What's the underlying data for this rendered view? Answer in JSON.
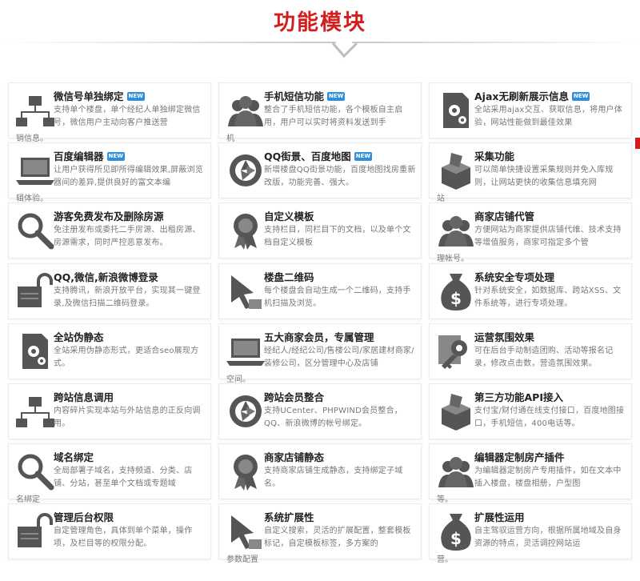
{
  "header": {
    "title": "功能模块",
    "accent": "#d41e1e"
  },
  "badge_color": "#2f8fdd",
  "modules": [
    {
      "name": "微信号单独绑定",
      "badge": "NEW",
      "desc": "支持单个楼盘，单个经纪人单独绑定微信号，微信用户主动向客户推送营",
      "overflow": "销信息。",
      "icon": "sitemap-icon"
    },
    {
      "name": "手机短信功能",
      "badge": "NEW",
      "desc": "整合了手机短信功能，各个模板自主启用，用户可以实时将资料发送到手",
      "overflow": "机",
      "icon": "users-icon"
    },
    {
      "name": "Ajax无刷新展示信息",
      "badge": "NEW",
      "desc": "全站采用ajax交互、获取信息，将用户体验，网站性能做到最佳效果",
      "overflow": "",
      "icon": "doc-gears-icon"
    },
    {
      "name": "百度编辑器",
      "badge": "NEW",
      "desc": "让用户获得所见即所得编辑效果,屏蔽浏览器间的差异,提供良好的富文本编",
      "overflow": "辑体验。",
      "icon": "laptop-icon"
    },
    {
      "name": "QQ街景、百度地图",
      "badge": "NEW",
      "desc": "新增楼盘QQ街景功能，百度地图找房重新改版，功能完善、强大。",
      "overflow": "",
      "icon": "aperture-icon"
    },
    {
      "name": "采集功能",
      "badge": "",
      "desc": "可以简单快捷设置采集规则并免入库规则，让网站更快的收集信息填充网",
      "overflow": "站",
      "icon": "box-icon"
    },
    {
      "name": "游客免费发布及删除房源",
      "badge": "",
      "desc": "免注册发布或委托二手房源、出租房源、房源需求，同时严控恶意发布。",
      "overflow": "",
      "icon": "magnifier-icon"
    },
    {
      "name": "自定义模板",
      "badge": "",
      "desc": "支持栏目，同栏目下的文档，以及单个文档自定义模板",
      "overflow": "",
      "icon": "award-icon"
    },
    {
      "name": "商家店铺代管",
      "badge": "",
      "desc": "方便网站为商家提供店铺代维、技术支持等增值服务，商家可指定多个管",
      "overflow": "理帐号。",
      "icon": "users-icon"
    },
    {
      "name": "QQ,微信,新浪微博登录",
      "badge": "",
      "desc": "支持腾讯，新浪开放平台，实现其一键登录,及微信扫描二维码登录。",
      "overflow": "",
      "icon": "unlock-icon"
    },
    {
      "name": "楼盘二维码",
      "badge": "",
      "desc": "每个楼盘会自动生成一个二维码，支持手机扫描及浏览。",
      "overflow": "",
      "icon": "cursor-icon"
    },
    {
      "name": "系统安全专项处理",
      "badge": "",
      "desc": "针对系统安全，如数据库、跨站XSS、文件系统等，进行专项处理。",
      "overflow": "",
      "icon": "money-bag-icon"
    },
    {
      "name": "全站伪静态",
      "badge": "",
      "desc": "全站采用伪静态形式，更适合seo展现方式。",
      "overflow": "",
      "icon": "doc-gears-icon"
    },
    {
      "name": "五大商家会员，专属管理",
      "badge": "",
      "desc": "经纪人/经纪公司/售楼公司/家居建材商家/装修公司，区分管理中心及店铺",
      "overflow": "空间。",
      "icon": "laptop-icon"
    },
    {
      "name": "运营氛围效果",
      "badge": "",
      "desc": "可在后台手动制造团购、活动等报名记录，修改点击数，营造氛围效果。",
      "overflow": "",
      "icon": "key-icon"
    },
    {
      "name": "跨站信息调用",
      "badge": "",
      "desc": "内容碎片实现本站与外站信息的正反向调用。",
      "overflow": "",
      "icon": "sitemap-icon"
    },
    {
      "name": "跨站会员整合",
      "badge": "",
      "desc": "支持UCenter、PHPWIND会员整合，QQ、新浪微博的帐号绑定。",
      "overflow": "",
      "icon": "aperture-icon"
    },
    {
      "name": "第三方功能API接入",
      "badge": "",
      "desc": "支付宝/财付通在线支付接口，百度地图接口，手机短信，400电话等。",
      "overflow": "",
      "icon": "box-icon"
    },
    {
      "name": "域名绑定",
      "badge": "",
      "desc": "全局部署子域名，支持频道、分类、店铺、分站，甚至单个文档或专题域",
      "overflow": "名绑定",
      "icon": "magnifier-icon"
    },
    {
      "name": "商家店铺静态",
      "badge": "",
      "desc": "支持商家店铺生成静态，支持绑定子域名。",
      "overflow": "",
      "icon": "award-icon"
    },
    {
      "name": "编辑器定制房产插件",
      "badge": "",
      "desc": "为编辑器定制房产专用插件，如在文本中插入楼盘，楼盘相册，户型图",
      "overflow": "等。",
      "icon": "users-icon"
    },
    {
      "name": "管理后台权限",
      "badge": "",
      "desc": "自定管理角色，具体到单个菜单，操作项，及栏目等的权限分配。",
      "overflow": "",
      "icon": "unlock-icon"
    },
    {
      "name": "系统扩展性",
      "badge": "",
      "desc": "自定义搜索，灵活的扩展配置，整套模板标记，自定模板标签，多方案的",
      "overflow": "参数配置",
      "icon": "cursor-icon"
    },
    {
      "name": "扩展性运用",
      "badge": "",
      "desc": "自主驾驭运营方向，根据所属地域及自身资源的特点，灵活调控网站运",
      "overflow": "营。",
      "icon": "money-bag-icon"
    }
  ]
}
